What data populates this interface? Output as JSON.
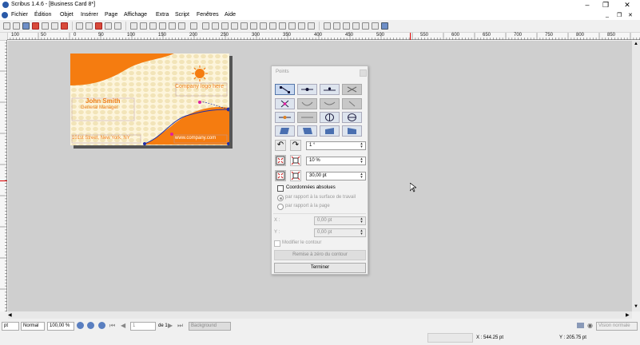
{
  "window": {
    "title": "Scribus 1.4.6 - [Business Card 8*]"
  },
  "menu": [
    "Fichier",
    "Édition",
    "Objet",
    "Insérer",
    "Page",
    "Affichage",
    "Extra",
    "Script",
    "Fenêtres",
    "Aide"
  ],
  "ruler": {
    "labels": [
      "100",
      "50",
      "0",
      "50",
      "100",
      "150",
      "200",
      "250",
      "300",
      "350",
      "400",
      "450",
      "500",
      "550",
      "600",
      "650",
      "700",
      "750",
      "800",
      "850"
    ]
  },
  "card": {
    "logo_text": "Company logo here",
    "name": "John Smith",
    "job_title": "General Manager",
    "address": "101st Street, New York, NY",
    "website": "www.company.com",
    "colors": {
      "orange": "#f57c10",
      "cream": "#fdf5dc",
      "dots": "#f2e4b8",
      "blue": "#1f2fa8",
      "magenta": "#e020a0",
      "text": "#f08020"
    }
  },
  "points_panel": {
    "title": "Points",
    "rotate_value": "1 °",
    "scale_value": "10 %",
    "size_value": "30,00 pt",
    "absolute_coords_label": "Coordonnées absolues",
    "radio_workspace": "par rapport à la surface de travail",
    "radio_page": "par rapport à la page",
    "x_label": "X :",
    "x_value": "0,00 pt",
    "y_label": "Y :",
    "y_value": "0,00 pt",
    "edit_contour_label": "Modifier le contour",
    "reset_contour_button": "Remise à zéro du contour",
    "finish_button": "Terminer"
  },
  "statusbar": {
    "unit": "pt",
    "mode": "Normal",
    "zoom": "100,00 %",
    "page_current": "1",
    "page_of": "de 1",
    "layer": "Background",
    "view": "Vision normale",
    "x_readout": "X : 544.25 pt",
    "y_readout": "Y : 205.75 pt"
  }
}
